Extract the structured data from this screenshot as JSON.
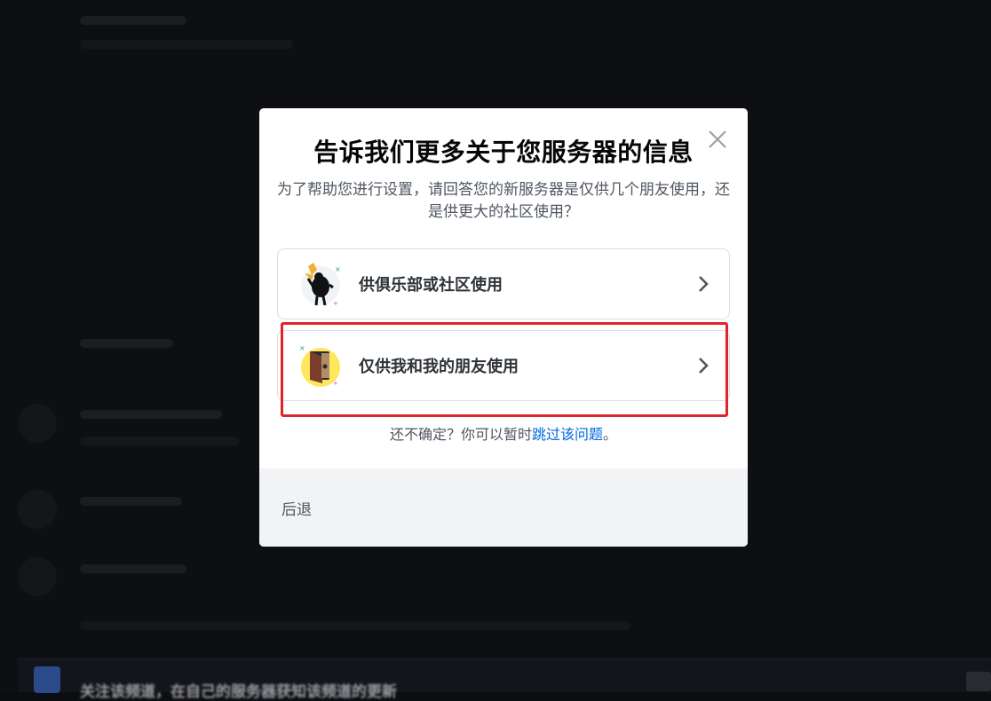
{
  "modal": {
    "title": "告诉我们更多关于您服务器的信息",
    "subtitle": "为了帮助您进行设置，请回答您的新服务器是仅供几个朋友使用，还是供更大的社区使用？",
    "options": [
      {
        "label": "供俱乐部或社区使用",
        "icon": "club-community-illustration-icon"
      },
      {
        "label": "仅供我和我的朋友使用",
        "icon": "friends-door-illustration-icon"
      }
    ],
    "skip": {
      "prefix": "还不确定？你可以暂时",
      "link": "跳过该问题",
      "suffix": "。"
    },
    "back_label": "后退"
  },
  "background": {
    "banner_text": "关注该频道，在自己的服务器获知该频道的更新"
  },
  "colors": {
    "link": "#0068e0",
    "highlight": "#e0232a",
    "footer": "#f2f3f5"
  }
}
